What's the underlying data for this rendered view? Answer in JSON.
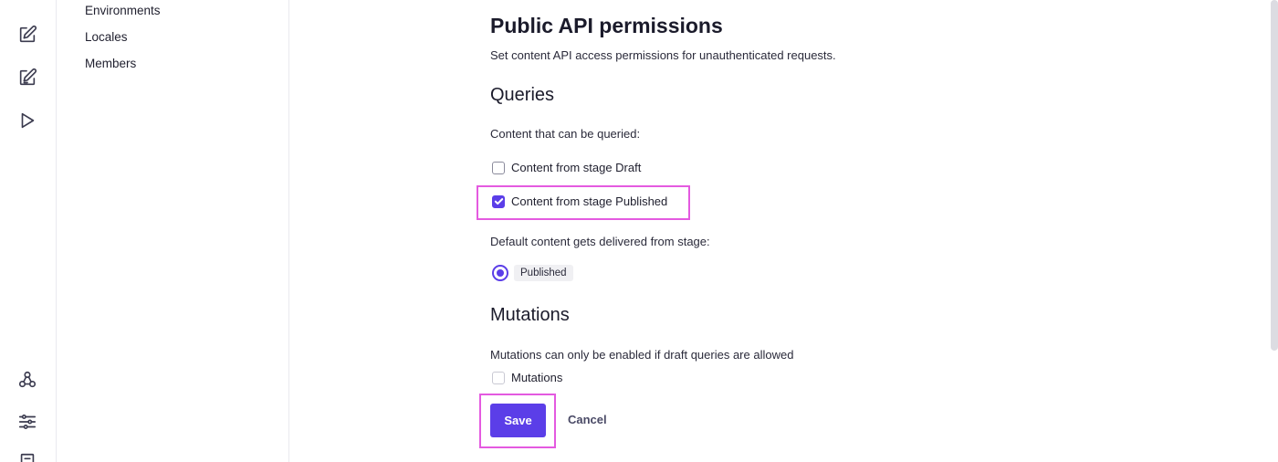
{
  "sidebar": {
    "icons": [
      "edit-icon",
      "edit-alt-icon",
      "play-icon",
      "webhook-icon",
      "sliders-icon",
      "document-icon"
    ]
  },
  "settings_nav": {
    "items": [
      {
        "label": "Environments"
      },
      {
        "label": "Locales"
      },
      {
        "label": "Members"
      }
    ]
  },
  "page": {
    "title": "Public API permissions",
    "subtitle": "Set content API access permissions for unauthenticated requests."
  },
  "queries": {
    "title": "Queries",
    "prompt": "Content that can be queried:",
    "options": [
      {
        "label": "Content from stage Draft",
        "checked": false
      },
      {
        "label": "Content from stage Published",
        "checked": true
      }
    ],
    "default_prompt": "Default content gets delivered from stage:",
    "default_stage": "Published"
  },
  "mutations": {
    "title": "Mutations",
    "note": "Mutations can only be enabled if draft queries are allowed",
    "option_label": "Mutations",
    "checked": false
  },
  "actions": {
    "save_label": "Save",
    "cancel_label": "Cancel"
  },
  "colors": {
    "accent": "#5b3ee8",
    "highlight": "#e45ae0"
  }
}
